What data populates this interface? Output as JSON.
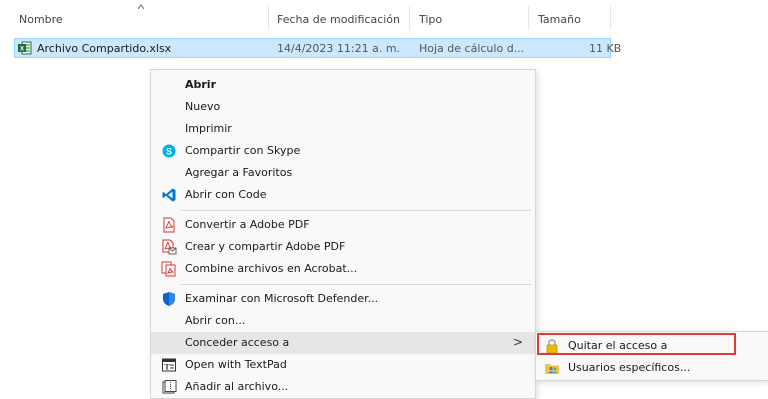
{
  "columns": {
    "name": "Nombre",
    "modified": "Fecha de modificación",
    "type": "Tipo",
    "size": "Tamaño"
  },
  "file": {
    "name": "Archivo Compartido.xlsx",
    "modified": "14/4/2023 11:21 a. m.",
    "type": "Hoja de cálculo d...",
    "size": "11 KB",
    "icon": "excel-file-icon"
  },
  "context_menu": {
    "open": "Abrir",
    "new": "Nuevo",
    "print": "Imprimir",
    "share_skype": "Compartir con Skype",
    "add_favorites": "Agregar a Favoritos",
    "open_code": "Abrir con Code",
    "convert_pdf": "Convertir a Adobe PDF",
    "create_share_pdf": "Crear y compartir Adobe PDF",
    "combine_acrobat": "Combine archivos en Acrobat...",
    "defender": "Examinar con Microsoft Defender...",
    "open_with": "Abrir con...",
    "grant_access": "Conceder acceso a",
    "grant_arrow": ">",
    "textpad": "Open with TextPad",
    "add_archive": "Añadir al archivo..."
  },
  "submenu": {
    "remove_access": "Quitar el acceso a",
    "specific_users": "Usuarios específicos..."
  },
  "colors": {
    "selection": "#cce8ff",
    "highlight_box": "#e5383b",
    "excel_green": "#1d6f42",
    "skype_blue": "#00aff0",
    "vscode_blue": "#0078d4",
    "pdf_red": "#d9342b",
    "defender_blue": "#0a64c8",
    "lock_yellow": "#f2b705"
  }
}
